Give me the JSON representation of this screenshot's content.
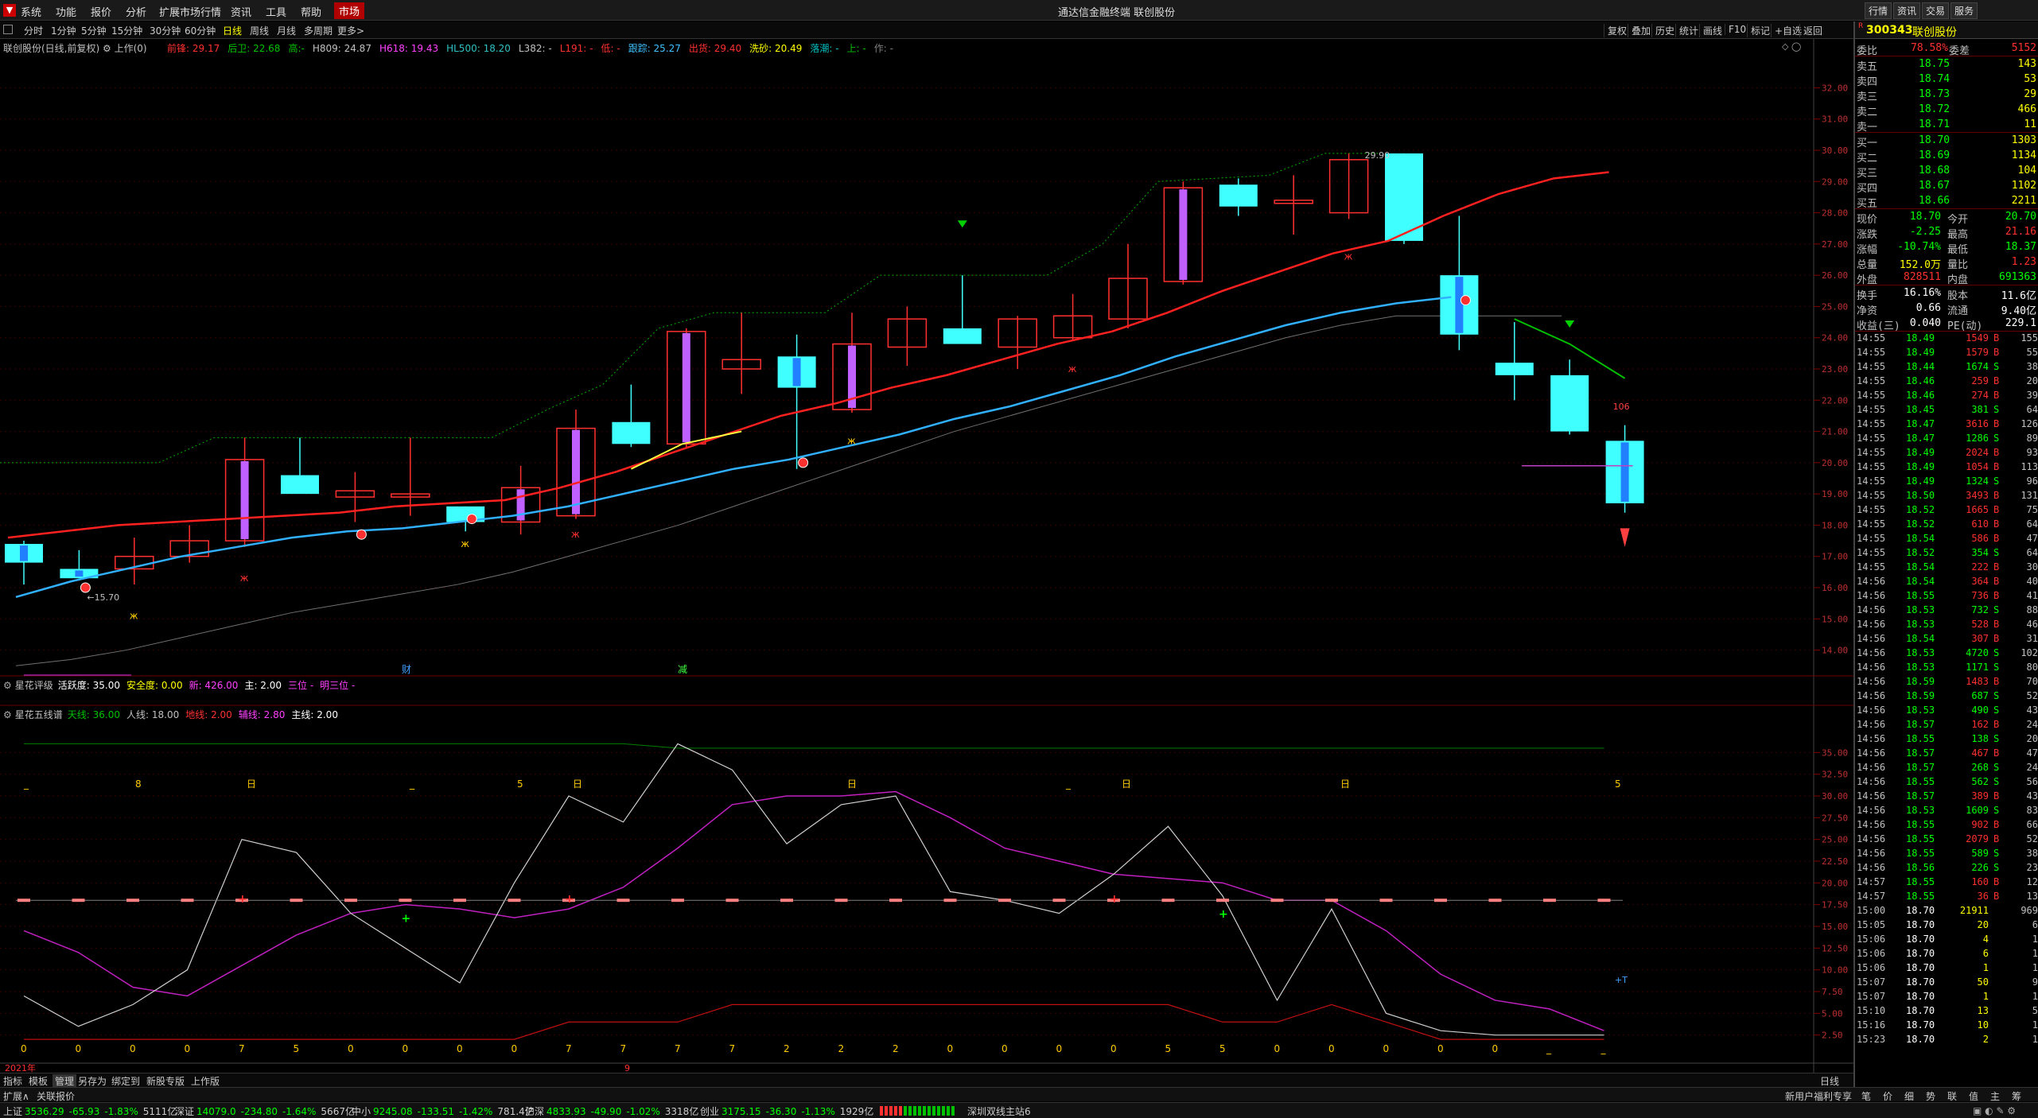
{
  "title_bar": {
    "app_title": "通达信金融终端 联创股份",
    "menus": [
      "系统",
      "功能",
      "报价",
      "分析",
      "扩展市场行情",
      "资讯",
      "工具",
      "帮助"
    ],
    "market_label": "市场",
    "right_buttons": [
      "行情",
      "资讯",
      "交易",
      "服务"
    ]
  },
  "toolbar": {
    "periods": [
      "分时",
      "1分钟",
      "5分钟",
      "15分钟",
      "30分钟",
      "60分钟",
      "日线",
      "周线",
      "月线",
      "多周期",
      "更多>"
    ],
    "active_period": "日线",
    "right_buttons": [
      "复权",
      "叠加",
      "历史",
      "统计",
      "画线",
      "F10",
      "标记",
      "+自选",
      "返回"
    ]
  },
  "main_chart": {
    "stock_label": "联创股份(日线,前复权)",
    "mode_label": "上作(0)",
    "indicators": [
      {
        "text": "前锋: 29.17",
        "color": "#ff3030"
      },
      {
        "text": "后卫: 22.68",
        "color": "#00c000"
      },
      {
        "text": "高:-",
        "color": "#00c000"
      },
      {
        "text": "H809: 24.87",
        "color": "#c0c0c0"
      },
      {
        "text": "H618: 19.43",
        "color": "#ff40ff"
      },
      {
        "text": "HL500: 18.20",
        "color": "#30c0c0"
      },
      {
        "text": "L382: -",
        "color": "#c0c0c0"
      },
      {
        "text": "L191: -",
        "color": "#ff3030"
      },
      {
        "text": "低: -",
        "color": "#ff3030"
      },
      {
        "text": "跟踪: 25.27",
        "color": "#40c0ff"
      },
      {
        "text": "出货: 29.40",
        "color": "#ff3030"
      },
      {
        "text": "洗砂: 20.49",
        "color": "#ffff00"
      },
      {
        "text": "落潮: -",
        "color": "#00c0c0"
      },
      {
        "text": "上: -",
        "color": "#00c000"
      },
      {
        "text": "作: -",
        "color": "#808080"
      }
    ],
    "yaxis": [
      "32.00",
      "31.00",
      "30.00",
      "29.00",
      "28.00",
      "27.00",
      "26.00",
      "25.00",
      "24.00",
      "23.00",
      "22.00",
      "21.00",
      "20.00",
      "19.00",
      "18.00",
      "17.00",
      "16.00",
      "15.00",
      "14.00"
    ],
    "annotations": {
      "high": "29.90",
      "low": "15.70",
      "last_count": "106",
      "marker_cai": "财",
      "marker_jian": "减"
    }
  },
  "panel2": {
    "name": "星花评级",
    "items": [
      {
        "text": "活跃度: 35.00",
        "color": "#ffffff"
      },
      {
        "text": "安全度: 0.00",
        "color": "#ffff00"
      },
      {
        "text": "新: 426.00",
        "color": "#ff40ff"
      },
      {
        "text": "主: 2.00",
        "color": "#ffffff"
      },
      {
        "text": "三位 -",
        "color": "#ff40ff"
      },
      {
        "text": "明三位 -",
        "color": "#ff40ff"
      }
    ]
  },
  "panel3": {
    "name": "星花五线谱",
    "items": [
      {
        "text": "天线: 36.00",
        "color": "#00c000"
      },
      {
        "text": "人线: 18.00",
        "color": "#c0c0c0"
      },
      {
        "text": "地线: 2.00",
        "color": "#ff3030"
      },
      {
        "text": "辅线: 2.80",
        "color": "#ff40ff"
      },
      {
        "text": "主线: 2.00",
        "color": "#ffffff"
      }
    ],
    "yaxis": [
      "35.00",
      "32.50",
      "30.00",
      "27.50",
      "25.00",
      "22.50",
      "20.00",
      "17.50",
      "15.00",
      "12.50",
      "10.00",
      "7.50",
      "5.00",
      "2.50"
    ],
    "bottom_values": [
      "0",
      "0",
      "0",
      "0",
      "7",
      "5",
      "0",
      "0",
      "0",
      "0",
      "7",
      "7",
      "7",
      "7",
      "2",
      "2",
      "2",
      "0",
      "0",
      "0",
      "0",
      "5",
      "5",
      "0",
      "0",
      "0",
      "0",
      "0",
      "_",
      "_"
    ],
    "top_marks": [
      "_",
      "8",
      "日",
      "_",
      "_",
      "5",
      "日",
      "日",
      "_",
      "日",
      "日",
      "5"
    ],
    "plus_t": "+T"
  },
  "x_axis": {
    "year": "2021年",
    "month": "9"
  },
  "bottom_tabs": [
    "指标",
    "模板",
    "管理",
    "另存为",
    "绑定到",
    "新股专版",
    "上作版"
  ],
  "right_label_daily": "日线",
  "expand_bar": {
    "left": "扩展∧",
    "item": "关联报价",
    "promo": "新用户福利专享",
    "tabs": [
      "笔",
      "价",
      "细",
      "势",
      "联",
      "值",
      "主",
      "筹"
    ]
  },
  "quote": {
    "code": "300343",
    "name": "联创股份",
    "wei_bi_label": "委比",
    "wei_bi": "78.58%",
    "wei_cha_label": "委差",
    "wei_cha": "5152",
    "sells": [
      {
        "label": "卖五",
        "price": "18.75",
        "vol": "143"
      },
      {
        "label": "卖四",
        "price": "18.74",
        "vol": "53"
      },
      {
        "label": "卖三",
        "price": "18.73",
        "vol": "29"
      },
      {
        "label": "卖二",
        "price": "18.72",
        "vol": "466"
      },
      {
        "label": "卖一",
        "price": "18.71",
        "vol": "11"
      }
    ],
    "buys": [
      {
        "label": "买一",
        "price": "18.70",
        "vol": "1303"
      },
      {
        "label": "买二",
        "price": "18.69",
        "vol": "1134"
      },
      {
        "label": "买三",
        "price": "18.68",
        "vol": "104"
      },
      {
        "label": "买四",
        "price": "18.67",
        "vol": "1102"
      },
      {
        "label": "买五",
        "price": "18.66",
        "vol": "2211"
      }
    ],
    "stats": [
      {
        "l1": "现价",
        "v1": "18.70",
        "c1": "#00ff00",
        "l2": "今开",
        "v2": "20.70",
        "c2": "#00ff00"
      },
      {
        "l1": "涨跌",
        "v1": "-2.25",
        "c1": "#00ff00",
        "l2": "最高",
        "v2": "21.16",
        "c2": "#ff3030"
      },
      {
        "l1": "涨幅",
        "v1": "-10.74%",
        "c1": "#00ff00",
        "l2": "最低",
        "v2": "18.37",
        "c2": "#00ff00"
      },
      {
        "l1": "总量",
        "v1": "152.0万",
        "c1": "#ffff00",
        "l2": "量比",
        "v2": "1.23",
        "c2": "#ff3030"
      },
      {
        "l1": "外盘",
        "v1": "828511",
        "c1": "#ff3030",
        "l2": "内盘",
        "v2": "691363",
        "c2": "#00ff00"
      },
      {
        "l1": "换手",
        "v1": "16.16%",
        "c1": "#ffffff",
        "l2": "股本",
        "v2": "11.6亿",
        "c2": "#ffffff"
      },
      {
        "l1": "净资",
        "v1": "0.66",
        "c1": "#ffffff",
        "l2": "流通",
        "v2": "9.40亿",
        "c2": "#ffffff"
      },
      {
        "l1": "收益(三)",
        "v1": "0.040",
        "c1": "#ffffff",
        "l2": "PE(动)",
        "v2": "229.1",
        "c2": "#ffffff"
      }
    ],
    "ticks": [
      [
        "14:55",
        "18.49",
        "1549",
        "B",
        "155"
      ],
      [
        "14:55",
        "18.49",
        "1579",
        "B",
        "55"
      ],
      [
        "14:55",
        "18.44",
        "1674",
        "S",
        "38"
      ],
      [
        "14:55",
        "18.46",
        "259",
        "B",
        "20"
      ],
      [
        "14:55",
        "18.46",
        "274",
        "B",
        "39"
      ],
      [
        "14:55",
        "18.45",
        "381",
        "S",
        "64"
      ],
      [
        "14:55",
        "18.47",
        "3616",
        "B",
        "126"
      ],
      [
        "14:55",
        "18.47",
        "1286",
        "S",
        "89"
      ],
      [
        "14:55",
        "18.49",
        "2024",
        "B",
        "93"
      ],
      [
        "14:55",
        "18.49",
        "1054",
        "B",
        "113"
      ],
      [
        "14:55",
        "18.49",
        "1324",
        "S",
        "96"
      ],
      [
        "14:55",
        "18.50",
        "3493",
        "B",
        "131"
      ],
      [
        "14:55",
        "18.52",
        "1665",
        "B",
        "75"
      ],
      [
        "14:55",
        "18.52",
        "610",
        "B",
        "64"
      ],
      [
        "14:55",
        "18.54",
        "586",
        "B",
        "47"
      ],
      [
        "14:55",
        "18.52",
        "354",
        "S",
        "64"
      ],
      [
        "14:55",
        "18.54",
        "222",
        "B",
        "30"
      ],
      [
        "14:56",
        "18.54",
        "364",
        "B",
        "40"
      ],
      [
        "14:56",
        "18.55",
        "736",
        "B",
        "41"
      ],
      [
        "14:56",
        "18.53",
        "732",
        "S",
        "88"
      ],
      [
        "14:56",
        "18.53",
        "528",
        "B",
        "46"
      ],
      [
        "14:56",
        "18.54",
        "307",
        "B",
        "31"
      ],
      [
        "14:56",
        "18.53",
        "4720",
        "S",
        "102"
      ],
      [
        "14:56",
        "18.53",
        "1171",
        "S",
        "80"
      ],
      [
        "14:56",
        "18.59",
        "1483",
        "B",
        "70"
      ],
      [
        "14:56",
        "18.59",
        "687",
        "S",
        "52"
      ],
      [
        "14:56",
        "18.53",
        "490",
        "S",
        "43"
      ],
      [
        "14:56",
        "18.57",
        "162",
        "B",
        "24"
      ],
      [
        "14:56",
        "18.55",
        "138",
        "S",
        "20"
      ],
      [
        "14:56",
        "18.57",
        "467",
        "B",
        "47"
      ],
      [
        "14:56",
        "18.57",
        "268",
        "S",
        "24"
      ],
      [
        "14:56",
        "18.55",
        "562",
        "S",
        "56"
      ],
      [
        "14:56",
        "18.57",
        "389",
        "B",
        "43"
      ],
      [
        "14:56",
        "18.53",
        "1609",
        "S",
        "83"
      ],
      [
        "14:56",
        "18.55",
        "902",
        "B",
        "66"
      ],
      [
        "14:56",
        "18.55",
        "2079",
        "B",
        "52"
      ],
      [
        "14:56",
        "18.55",
        "589",
        "S",
        "38"
      ],
      [
        "14:56",
        "18.56",
        "226",
        "S",
        "23"
      ],
      [
        "14:57",
        "18.55",
        "160",
        "B",
        "12"
      ],
      [
        "14:57",
        "18.55",
        "36",
        "B",
        "13"
      ],
      [
        "15:00",
        "18.70",
        "21911",
        "",
        "969"
      ],
      [
        "15:05",
        "18.70",
        "20",
        "",
        "6"
      ],
      [
        "15:06",
        "18.70",
        "4",
        "",
        "1"
      ],
      [
        "15:06",
        "18.70",
        "6",
        "",
        "1"
      ],
      [
        "15:06",
        "18.70",
        "1",
        "",
        "1"
      ],
      [
        "15:07",
        "18.70",
        "50",
        "",
        "9"
      ],
      [
        "15:07",
        "18.70",
        "1",
        "",
        "1"
      ],
      [
        "15:10",
        "18.70",
        "13",
        "",
        "5"
      ],
      [
        "15:16",
        "18.70",
        "10",
        "",
        "1"
      ],
      [
        "15:23",
        "18.70",
        "2",
        "",
        "1"
      ]
    ]
  },
  "status_bar": {
    "items": [
      {
        "name": "上证",
        "val": "3536.29",
        "chg": "-65.93",
        "pct": "-1.83%",
        "amt": "5111亿"
      },
      {
        "name": "深证",
        "val": "14079.0",
        "chg": "-234.80",
        "pct": "-1.64%",
        "amt": "5667亿"
      },
      {
        "name": "中小",
        "val": "9245.08",
        "chg": "-133.51",
        "pct": "-1.42%",
        "amt": "781.4亿"
      },
      {
        "name": "沪深",
        "val": "4833.93",
        "chg": "-49.90",
        "pct": "-1.02%",
        "amt": "3318亿"
      },
      {
        "name": "创业",
        "val": "3175.15",
        "chg": "-36.30",
        "pct": "-1.13%",
        "amt": "1929亿"
      }
    ],
    "server": "深圳双线主站6"
  },
  "chart_data": {
    "type": "candlestick",
    "price_range": [
      13.2,
      32.8
    ],
    "candles": [
      {
        "o": 16.8,
        "h": 17.5,
        "l": 16.1,
        "c": 17.4,
        "up": false,
        "mark": true
      },
      {
        "o": 16.6,
        "h": 17.2,
        "l": 16.3,
        "c": 16.3,
        "up": false,
        "mark": true
      },
      {
        "o": 16.6,
        "h": 17.6,
        "l": 16.1,
        "c": 17.0,
        "up": true
      },
      {
        "o": 17.0,
        "h": 18.0,
        "l": 16.8,
        "c": 17.5,
        "up": true
      },
      {
        "o": 17.5,
        "h": 20.8,
        "l": 17.3,
        "c": 20.1,
        "up": true,
        "mark": true
      },
      {
        "o": 19.6,
        "h": 20.8,
        "l": 19.3,
        "c": 19.0,
        "up": false
      },
      {
        "o": 19.1,
        "h": 19.7,
        "l": 18.1,
        "c": 18.9,
        "up": true
      },
      {
        "o": 18.9,
        "h": 20.8,
        "l": 18.3,
        "c": 19.0,
        "up": true
      },
      {
        "o": 18.1,
        "h": 18.6,
        "l": 17.8,
        "c": 18.6,
        "up": false
      },
      {
        "o": 18.1,
        "h": 19.9,
        "l": 17.7,
        "c": 19.2,
        "up": true,
        "mark": true
      },
      {
        "o": 18.3,
        "h": 21.7,
        "l": 18.2,
        "c": 21.1,
        "up": true,
        "mark": true
      },
      {
        "o": 20.6,
        "h": 22.5,
        "l": 20.5,
        "c": 21.3,
        "up": false
      },
      {
        "o": 20.6,
        "h": 24.3,
        "l": 20.5,
        "c": 24.2,
        "up": true,
        "mark": true
      },
      {
        "o": 23.0,
        "h": 24.8,
        "l": 22.2,
        "c": 23.3,
        "up": true
      },
      {
        "o": 22.4,
        "h": 24.1,
        "l": 19.8,
        "c": 23.4,
        "up": false,
        "mark": true
      },
      {
        "o": 21.7,
        "h": 24.8,
        "l": 21.6,
        "c": 23.8,
        "up": true,
        "mark": true
      },
      {
        "o": 23.7,
        "h": 25.0,
        "l": 23.1,
        "c": 24.6,
        "up": true
      },
      {
        "o": 24.3,
        "h": 26.0,
        "l": 23.9,
        "c": 23.8,
        "up": false
      },
      {
        "o": 23.7,
        "h": 24.7,
        "l": 23.0,
        "c": 24.6,
        "up": true
      },
      {
        "o": 24.0,
        "h": 25.4,
        "l": 23.9,
        "c": 24.7,
        "up": true
      },
      {
        "o": 24.6,
        "h": 27.0,
        "l": 24.3,
        "c": 25.9,
        "up": true
      },
      {
        "o": 25.8,
        "h": 29.0,
        "l": 25.7,
        "c": 28.8,
        "up": true,
        "mark": true
      },
      {
        "o": 28.2,
        "h": 29.1,
        "l": 27.9,
        "c": 28.9,
        "up": false
      },
      {
        "o": 28.4,
        "h": 29.2,
        "l": 27.3,
        "c": 28.3,
        "up": true
      },
      {
        "o": 28.0,
        "h": 29.9,
        "l": 27.8,
        "c": 29.7,
        "up": true
      },
      {
        "o": 29.9,
        "h": 29.9,
        "l": 27.0,
        "c": 27.1,
        "up": false
      },
      {
        "o": 26.0,
        "h": 27.9,
        "l": 23.6,
        "c": 24.1,
        "up": false,
        "mark": true
      },
      {
        "o": 23.2,
        "h": 24.5,
        "l": 22.0,
        "c": 22.8,
        "up": false
      },
      {
        "o": 22.8,
        "h": 23.3,
        "l": 20.9,
        "c": 21.0,
        "up": false
      },
      {
        "o": 20.7,
        "h": 21.2,
        "l": 18.4,
        "c": 18.7,
        "up": false,
        "mark": true
      }
    ],
    "ma_red": [
      17.6,
      17.8,
      18.0,
      18.1,
      18.2,
      18.3,
      18.4,
      18.6,
      18.7,
      18.8,
      19.2,
      19.7,
      20.3,
      20.9,
      21.5,
      21.9,
      22.4,
      22.8,
      23.3,
      23.8,
      24.2,
      24.8,
      25.5,
      26.1,
      26.7,
      27.1,
      27.9,
      28.6,
      29.1,
      29.3
    ],
    "ma_blue": [
      15.7,
      16.2,
      16.6,
      17.0,
      17.3,
      17.6,
      17.8,
      17.9,
      18.1,
      18.3,
      18.6,
      19.0,
      19.4,
      19.8,
      20.1,
      20.5,
      20.9,
      21.4,
      21.8,
      22.3,
      22.8,
      23.4,
      23.9,
      24.4,
      24.8,
      25.1,
      25.3
    ],
    "stair_high": [
      20.0,
      20.0,
      20.0,
      20.0,
      20.8,
      20.8,
      20.8,
      20.8,
      20.8,
      20.8,
      21.7,
      22.5,
      24.3,
      24.8,
      24.8,
      24.8,
      26.0,
      26.0,
      26.0,
      26.0,
      27.0,
      29.0,
      29.1,
      29.2,
      29.9,
      29.9
    ],
    "stair_low": [
      13.5,
      13.7,
      14.0,
      14.4,
      14.8,
      15.2,
      15.5,
      15.8,
      16.1,
      16.5,
      17.0,
      17.5,
      18.0,
      18.6,
      19.2,
      19.8,
      20.4,
      21.0,
      21.5,
      22.0,
      22.5,
      23.0,
      23.5,
      24.0,
      24.4,
      24.7,
      24.7,
      24.7,
      24.7
    ],
    "sub_white": [
      7,
      3.5,
      6,
      10,
      25,
      23.5,
      16.5,
      12.5,
      8.5,
      20,
      30,
      27,
      36,
      33,
      24.5,
      29,
      30,
      19,
      18,
      16.5,
      21,
      26.5,
      18.5,
      6.5,
      17,
      5,
      3,
      2.5,
      2.5,
      2.5
    ],
    "sub_purple": [
      14.5,
      12,
      8,
      7,
      10.5,
      14,
      16.5,
      17.5,
      17,
      16,
      17,
      19.5,
      24,
      29,
      30,
      30,
      30.5,
      27.5,
      24,
      22.5,
      21,
      20.5,
      20,
      18,
      18,
      14.5,
      9.5,
      6.5,
      5.5,
      3
    ],
    "sub_red": [
      2,
      2,
      2,
      2,
      2,
      2,
      2,
      2,
      2,
      2,
      4,
      4,
      4,
      6,
      6,
      6,
      6,
      6,
      6,
      6,
      6,
      6,
      4,
      4,
      6,
      4,
      2,
      2,
      2,
      2
    ],
    "sub_green": [
      36,
      36,
      36,
      36,
      36,
      36,
      36,
      36,
      36,
      36,
      36,
      36,
      35.5,
      35.5,
      35.5,
      35.5,
      35.5,
      35.5,
      35.5,
      35.5,
      35.5,
      35.5,
      35.5,
      35.5,
      35.5,
      35.5,
      35.5,
      35.5,
      35.5,
      35.5
    ],
    "sub_range": [
      0,
      37.5
    ]
  }
}
